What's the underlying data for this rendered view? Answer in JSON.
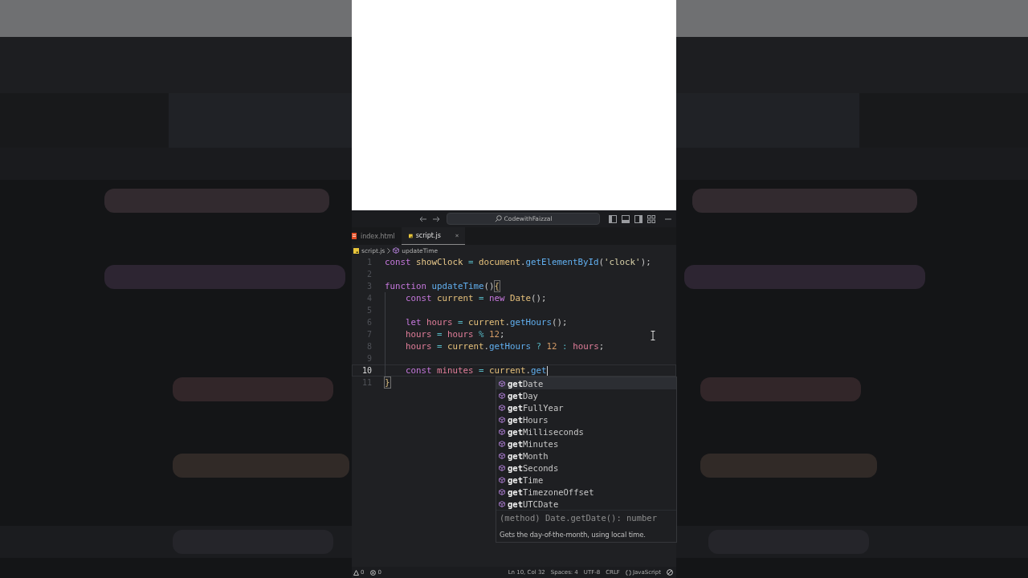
{
  "title_bar": {
    "search": "CodewithFaizzal"
  },
  "tabs": [
    {
      "label": "index.html",
      "kind": "html",
      "selected": false
    },
    {
      "label": "script.js",
      "kind": "js",
      "selected": true
    }
  ],
  "breadcrumb": {
    "file": "script.js",
    "symbol": "updateTime"
  },
  "code": [
    {
      "number": "1",
      "current": false,
      "indented": false,
      "tokens": [
        {
          "kind": "kw",
          "text": "const"
        },
        {
          "kind": "var",
          "text": " showClock"
        },
        {
          "kind": "op",
          "text": " ="
        },
        {
          "kind": "obj",
          "text": " document"
        },
        {
          "kind": "plain",
          "text": "."
        },
        {
          "kind": "fn",
          "text": "getElementById"
        },
        {
          "kind": "plain",
          "text": "("
        },
        {
          "kind": "str",
          "text": "'clock'"
        },
        {
          "kind": "plain",
          "text": ");"
        }
      ]
    },
    {
      "number": "2",
      "current": false,
      "indented": false
    },
    {
      "number": "3",
      "current": false,
      "indented": false,
      "tokens": [
        {
          "kind": "kw",
          "text": "function"
        },
        {
          "kind": "fn",
          "text": " updateTime"
        },
        {
          "kind": "plain",
          "text": "()"
        },
        {
          "kind": "bracket",
          "text": "{"
        }
      ]
    },
    {
      "number": "4",
      "current": false,
      "indented": true,
      "tokens": [
        {
          "kind": "kw",
          "text": "const"
        },
        {
          "kind": "obj",
          "text": " current"
        },
        {
          "kind": "op",
          "text": " ="
        },
        {
          "kind": "kw",
          "text": " new"
        },
        {
          "kind": "cls",
          "text": " Date"
        },
        {
          "kind": "plain",
          "text": "();"
        }
      ]
    },
    {
      "number": "5",
      "current": false,
      "indented": true
    },
    {
      "number": "6",
      "current": false,
      "indented": true,
      "tokens": [
        {
          "kind": "kw",
          "text": "let"
        },
        {
          "kind": "var2",
          "text": " hours"
        },
        {
          "kind": "op",
          "text": " ="
        },
        {
          "kind": "obj",
          "text": " current"
        },
        {
          "kind": "plain",
          "text": "."
        },
        {
          "kind": "fn",
          "text": "getHours"
        },
        {
          "kind": "plain",
          "text": "();"
        }
      ]
    },
    {
      "number": "7",
      "current": false,
      "indented": true,
      "tokens": [
        {
          "kind": "var2",
          "text": "hours"
        },
        {
          "kind": "op",
          "text": " ="
        },
        {
          "kind": "var2",
          "text": " hours"
        },
        {
          "kind": "op",
          "text": " %"
        },
        {
          "kind": "num",
          "text": " 12"
        },
        {
          "kind": "plain",
          "text": ";"
        }
      ]
    },
    {
      "number": "8",
      "current": false,
      "indented": true,
      "tokens": [
        {
          "kind": "var2",
          "text": "hours"
        },
        {
          "kind": "op",
          "text": " ="
        },
        {
          "kind": "obj",
          "text": " current"
        },
        {
          "kind": "plain",
          "text": "."
        },
        {
          "kind": "fn",
          "text": "getHours"
        },
        {
          "kind": "op",
          "text": " ?"
        },
        {
          "kind": "num",
          "text": " 12"
        },
        {
          "kind": "op",
          "text": " :"
        },
        {
          "kind": "var2",
          "text": " hours"
        },
        {
          "kind": "plain",
          "text": ";"
        }
      ]
    },
    {
      "number": "9",
      "current": false,
      "indented": true
    },
    {
      "number": "10",
      "current": true,
      "indented": true,
      "tokens": [
        {
          "kind": "kw",
          "text": "const"
        },
        {
          "kind": "var2",
          "text": " minutes"
        },
        {
          "kind": "op",
          "text": " ="
        },
        {
          "kind": "obj",
          "text": " current"
        },
        {
          "kind": "plain",
          "text": "."
        },
        {
          "kind": "fn",
          "text": "get"
        }
      ]
    },
    {
      "number": "11",
      "current": false,
      "indented": false,
      "tokens": [
        {
          "kind": "bracket",
          "text": "}"
        }
      ]
    }
  ],
  "suggestions": [
    {
      "label": "**get**Date",
      "selected": true
    },
    {
      "label": "**get**Day",
      "selected": false
    },
    {
      "label": "**get**FullYear",
      "selected": false
    },
    {
      "label": "**get**Hours",
      "selected": false
    },
    {
      "label": "**get**Milliseconds",
      "selected": false
    },
    {
      "label": "**get**Minutes",
      "selected": false
    },
    {
      "label": "**get**Month",
      "selected": false
    },
    {
      "label": "**get**Seconds",
      "selected": false
    },
    {
      "label": "**get**Time",
      "selected": false
    },
    {
      "label": "**get**TimezoneOffset",
      "selected": false
    },
    {
      "label": "**get**UTCDate",
      "selected": false
    }
  ],
  "suggestion_detail": {
    "signature": "(method) Date.getDate(): number",
    "description": "Gets the day-of-the-month, using local time."
  },
  "status_bar": {
    "problems": [
      {
        "kind": "warning",
        "count": "0"
      },
      {
        "kind": "error",
        "count": "0"
      }
    ],
    "items": [
      {
        "kind": "text",
        "text": "Ln 10, Col 32"
      },
      {
        "kind": "text",
        "text": "Spaces: 4"
      },
      {
        "kind": "text",
        "text": "UTF-8"
      },
      {
        "kind": "text",
        "text": "CRLF"
      },
      {
        "kind": "language",
        "text": "JavaScript"
      }
    ]
  }
}
